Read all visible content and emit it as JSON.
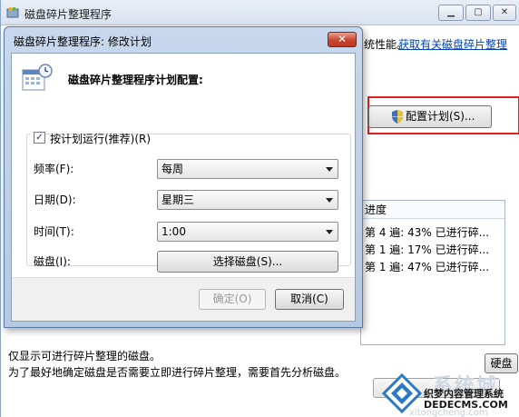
{
  "main_window": {
    "title": "磁盘碎片整理程序",
    "performance_text_tail": "统性能。",
    "link_text": "获取有关磁盘碎片整理",
    "configure_schedule_button": "配置计划(S)...",
    "progress_header": "进度",
    "progress_rows": [
      "第 4 遍: 43% 已进行碎...",
      "第 1 遍: 17% 已进行碎...",
      "第 1 遍: 47% 已进行碎..."
    ],
    "note_line1": "仅显示可进行碎片整理的磁盘。",
    "note_line2": "为了最好地确定磁盘是否需要立即进行碎片整理，需要首先分析磁盘。",
    "disk_button": "硬盘",
    "window_buttons": {
      "minimize": "▁",
      "maximize": "▢",
      "close": "✕"
    }
  },
  "dialog": {
    "title": "磁盘碎片整理程序: 修改计划",
    "close_label": "✕",
    "heading": "磁盘碎片整理程序计划配置:",
    "run_on_schedule": {
      "label": "按计划运行(推荐)(R)",
      "checked_glyph": "✓"
    },
    "frequency": {
      "label": "频率(F):",
      "value": "每周"
    },
    "day": {
      "label": "日期(D):",
      "value": "星期三"
    },
    "time": {
      "label": "时间(T):",
      "value": "1:00"
    },
    "disks": {
      "label": "磁盘(I):",
      "button": "选择磁盘(S)..."
    },
    "ok_button": "确定(O)",
    "cancel_button": "取消(C)"
  },
  "watermark": {
    "big": "系统城",
    "cn": "织梦内容管理系统",
    "en": "DEDECMS.COM",
    "url": "xitongcheng.com"
  },
  "colors": {
    "highlight_border": "#e02020",
    "link": "#0645ad",
    "dialog_frame": "#b6c9e2",
    "close_button": "#c9462f"
  }
}
